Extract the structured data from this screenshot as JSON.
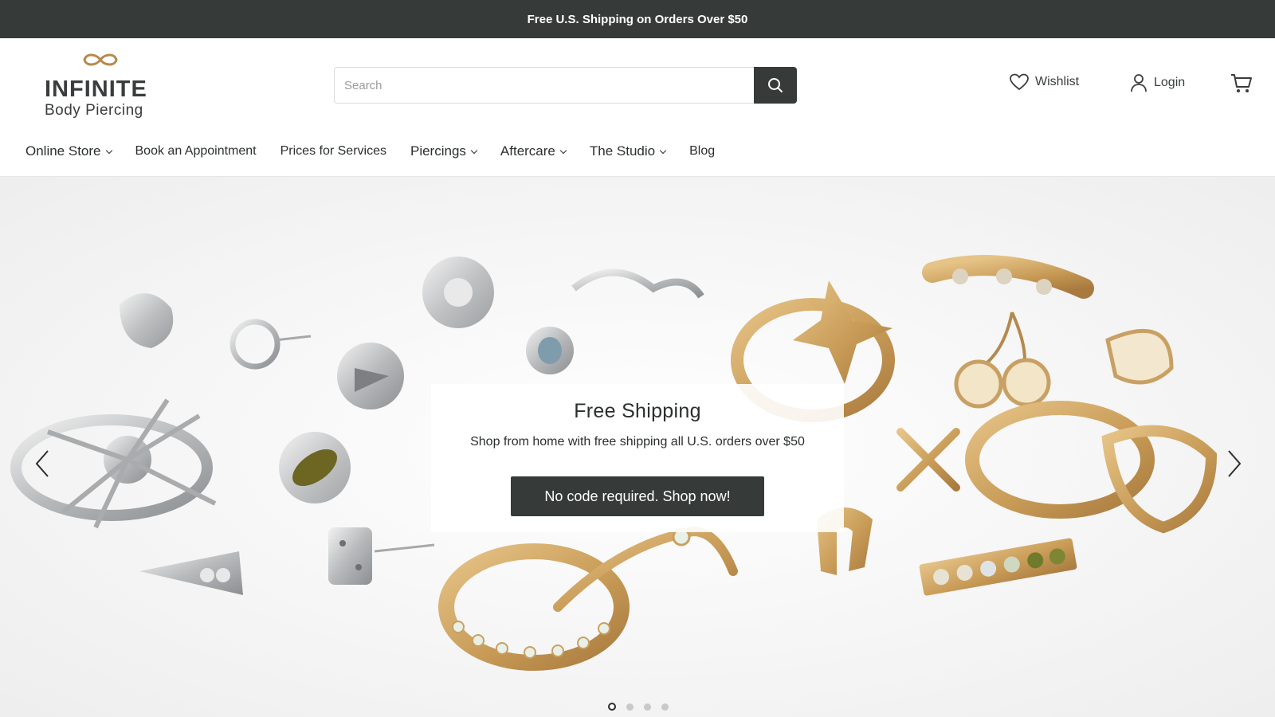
{
  "announcement": "Free U.S. Shipping on Orders Over $50",
  "brand": {
    "line1": "INFINITE",
    "line2": "Body Piercing",
    "accent_color": "#b8894a"
  },
  "search": {
    "placeholder": "Search",
    "icon": "search-icon"
  },
  "utility": {
    "wishlist": "Wishlist",
    "login": "Login",
    "cart_icon": "cart-icon"
  },
  "nav": {
    "items": [
      {
        "label": "Online Store",
        "dropdown": true
      },
      {
        "label": "Book an Appointment",
        "dropdown": false
      },
      {
        "label": "Prices for Services",
        "dropdown": false
      },
      {
        "label": "Piercings",
        "dropdown": true
      },
      {
        "label": "Aftercare",
        "dropdown": true
      },
      {
        "label": "The Studio",
        "dropdown": true
      },
      {
        "label": "Blog",
        "dropdown": false
      }
    ]
  },
  "hero": {
    "title": "Free Shipping",
    "subtitle": "Shop from home with free shipping all U.S. orders over $50",
    "cta": "No code required. Shop now!",
    "slides": 4,
    "active_slide": 1
  },
  "colors": {
    "dark": "#363b3a",
    "gold": "#c9a063",
    "silver": "#b9bcbe"
  }
}
